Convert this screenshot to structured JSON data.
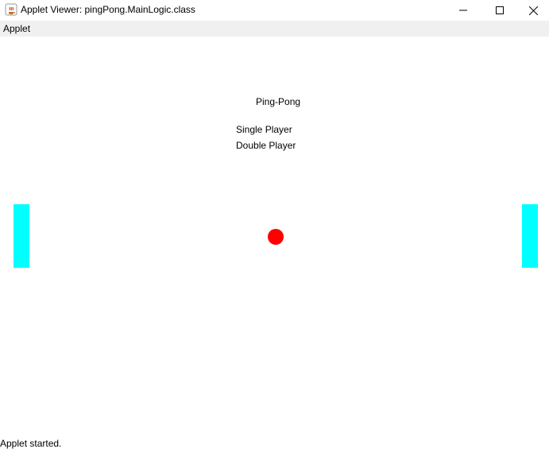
{
  "window": {
    "title": "Applet Viewer: pingPong.MainLogic.class",
    "icon": "java-coffee-icon",
    "controls": {
      "minimize_icon": "minimize-icon",
      "maximize_icon": "maximize-icon",
      "close_icon": "close-icon"
    }
  },
  "menubar": {
    "items": [
      {
        "label": "Applet"
      }
    ]
  },
  "game": {
    "title": "Ping-Pong",
    "options": [
      {
        "label": "Single Player"
      },
      {
        "label": "Double Player"
      }
    ],
    "colors": {
      "paddle": "#00ffff",
      "ball": "#ff0000"
    }
  },
  "status": {
    "text": "Applet started."
  }
}
